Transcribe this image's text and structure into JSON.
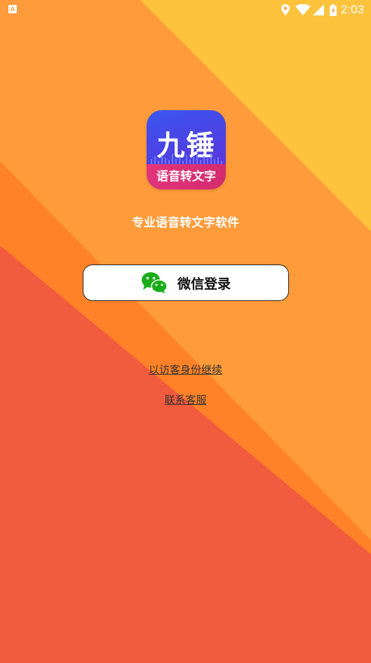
{
  "status_bar": {
    "notification_label": "A",
    "time": "2:03",
    "icons": [
      "location-icon",
      "wifi-icon",
      "signal-icon",
      "battery-icon"
    ]
  },
  "app": {
    "icon_title": "九锤",
    "icon_banner": "语音转文字",
    "tagline": "专业语音转文字软件"
  },
  "login": {
    "wechat_label": "微信登录",
    "guest_link": "以访客身份继续",
    "contact_link": "联系客服"
  },
  "colors": {
    "bg_yellow": "#FFC23C",
    "bg_orange_light": "#FF9B3A",
    "bg_orange_dark": "#FF8228",
    "bg_red": "#F15B3E",
    "wechat_green": "#1AAD19"
  }
}
